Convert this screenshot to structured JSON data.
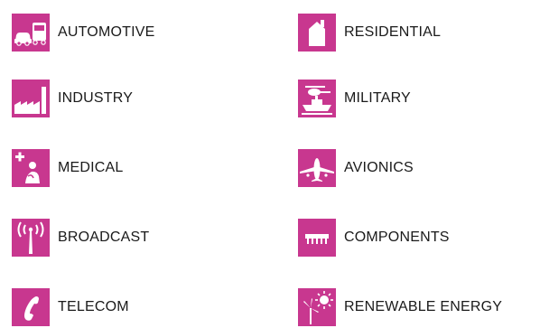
{
  "colors": {
    "icon_background": "#c8378f",
    "icon_foreground": "#ffffff",
    "label_text": "#1a1a1a"
  },
  "sectors": [
    {
      "label": "AUTOMOTIVE",
      "icon": "car-truck-icon"
    },
    {
      "label": "RESIDENTIAL",
      "icon": "house-icon"
    },
    {
      "label": "INDUSTRY",
      "icon": "factory-icon"
    },
    {
      "label": "MILITARY",
      "icon": "helicopter-ship-icon"
    },
    {
      "label": "MEDICAL",
      "icon": "medical-patient-icon"
    },
    {
      "label": "AVIONICS",
      "icon": "airplane-icon"
    },
    {
      "label": "BROADCAST",
      "icon": "antenna-icon"
    },
    {
      "label": "COMPONENTS",
      "icon": "chip-icon"
    },
    {
      "label": "TELECOM",
      "icon": "telephone-icon"
    },
    {
      "label": "RENEWABLE ENERGY",
      "icon": "wind-sun-icon"
    }
  ]
}
